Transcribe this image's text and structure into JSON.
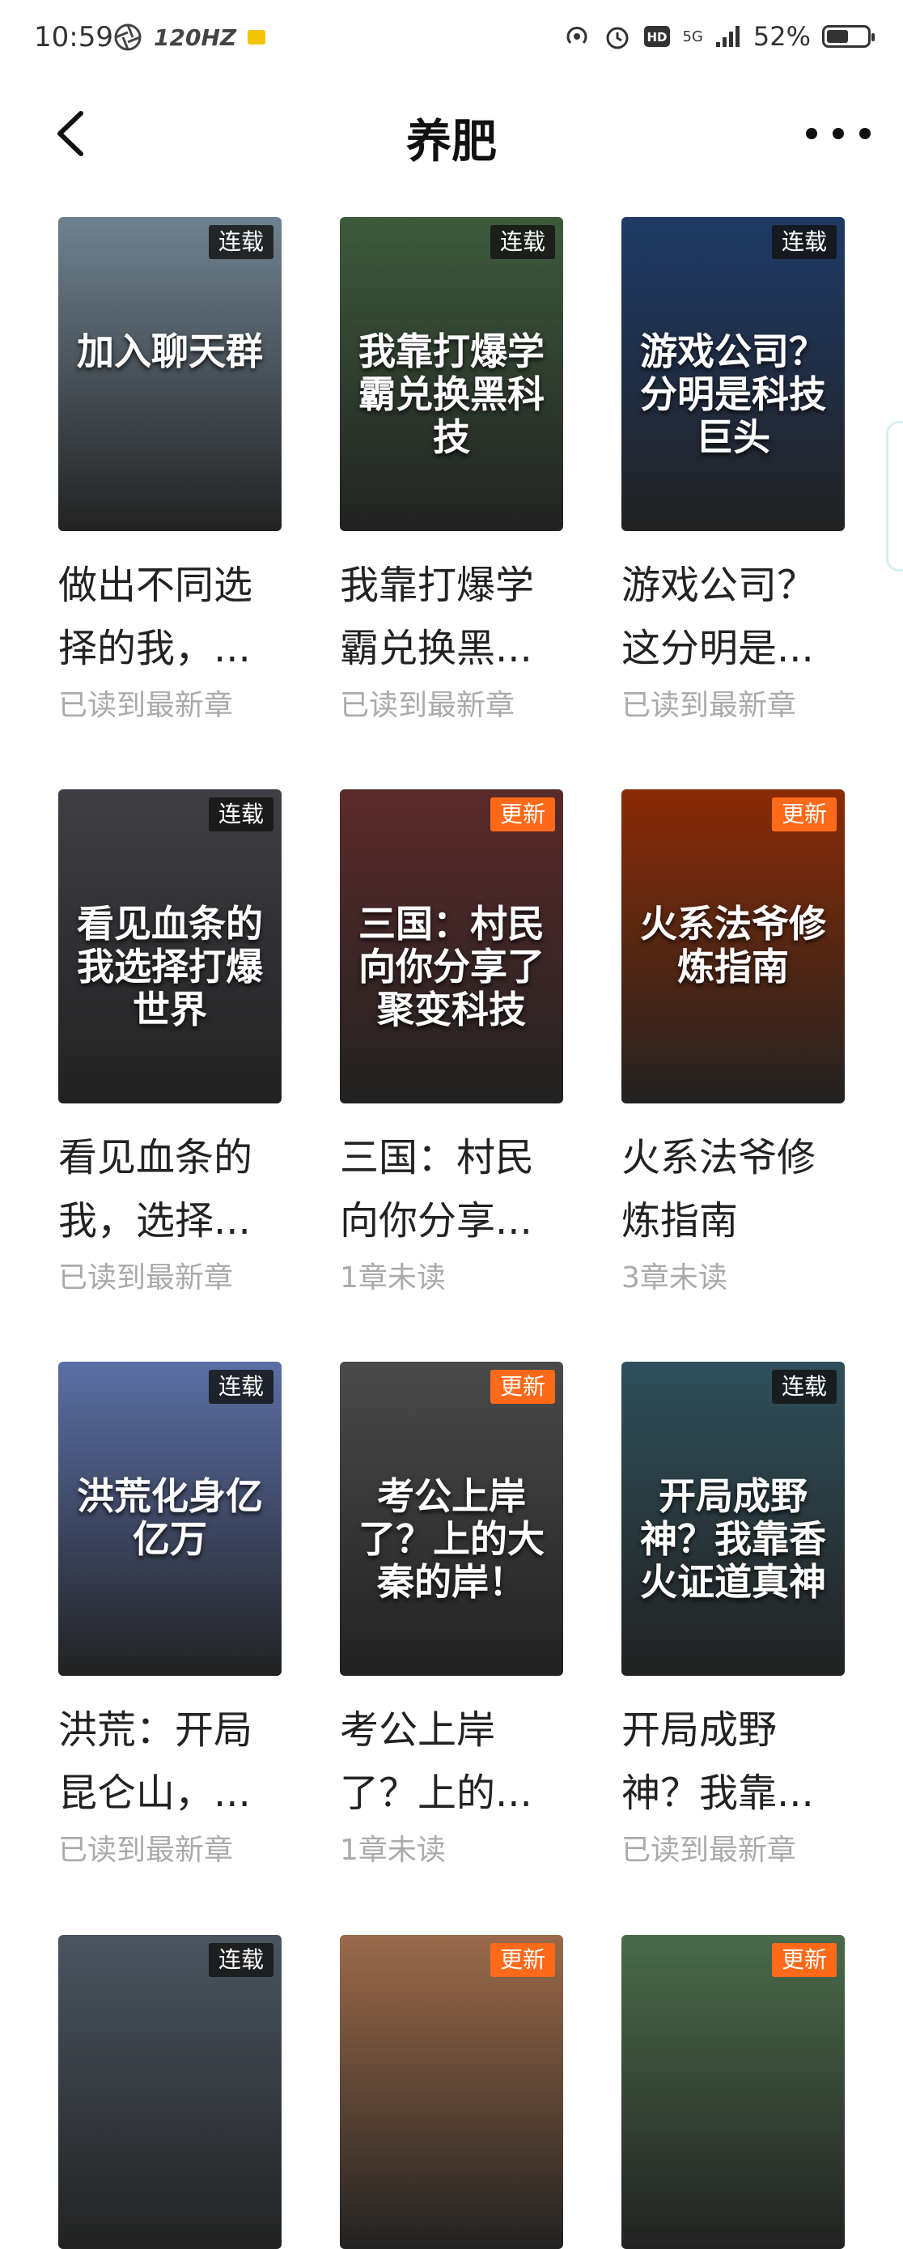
{
  "status_bar": {
    "time": "10:59",
    "refresh": "120HZ",
    "network": "5G",
    "battery": "52%"
  },
  "header": {
    "title": "养肥"
  },
  "books": [
    {
      "cover_text": "加入聊天群",
      "badge": "连载",
      "badge_type": "serial",
      "title_line1": "做出不同选",
      "title_line2": "择的我，...",
      "status": "已读到最新章",
      "cover_color": "#6f8290"
    },
    {
      "cover_text": "我靠打爆学霸兑换黑科技",
      "badge": "连载",
      "badge_type": "serial",
      "title_line1": "我靠打爆学",
      "title_line2": "霸兑换黑...",
      "status": "已读到最新章",
      "cover_color": "#3d5a3c"
    },
    {
      "cover_text": "游戏公司？分明是科技巨头",
      "badge": "连载",
      "badge_type": "serial",
      "title_line1": "游戏公司？",
      "title_line2": "这分明是...",
      "status": "已读到最新章",
      "cover_color": "#1f3a66"
    },
    {
      "cover_text": "看见血条的我选择打爆世界",
      "badge": "连载",
      "badge_type": "serial",
      "title_line1": "看见血条的",
      "title_line2": "我，选择...",
      "status": "已读到最新章",
      "cover_color": "#3e3e44"
    },
    {
      "cover_text": "三国：村民向你分享了聚变科技",
      "badge": "更新",
      "badge_type": "update",
      "title_line1": "三国：村民",
      "title_line2": "向你分享...",
      "status": "1章未读",
      "cover_color": "#5a2a2a"
    },
    {
      "cover_text": "火系法爷修炼指南",
      "badge": "更新",
      "badge_type": "update",
      "title_line1": "火系法爷修",
      "title_line2": "炼指南",
      "status": "3章未读",
      "cover_color": "#8a2b05"
    },
    {
      "cover_text": "洪荒化身亿亿万",
      "badge": "连载",
      "badge_type": "serial",
      "title_line1": "洪荒：开局",
      "title_line2": "昆仑山，...",
      "status": "已读到最新章",
      "cover_color": "#5b6fa6"
    },
    {
      "cover_text": "考公上岸了？上的大秦的岸！",
      "badge": "更新",
      "badge_type": "update",
      "title_line1": "考公上岸",
      "title_line2": "了？上的...",
      "status": "1章未读",
      "cover_color": "#4a4a4a"
    },
    {
      "cover_text": "开局成野神？我靠香火证道真神",
      "badge": "连载",
      "badge_type": "serial",
      "title_line1": "开局成野",
      "title_line2": "神？我靠...",
      "status": "已读到最新章",
      "cover_color": "#2f4f5a"
    },
    {
      "cover_text": "",
      "badge": "连载",
      "badge_type": "serial",
      "title_line1": "",
      "title_line2": "",
      "status": "",
      "cover_color": "#4a5560"
    },
    {
      "cover_text": "",
      "badge": "更新",
      "badge_type": "update",
      "title_line1": "",
      "title_line2": "",
      "status": "",
      "cover_color": "#9a6a4a"
    },
    {
      "cover_text": "",
      "badge": "更新",
      "badge_type": "update",
      "title_line1": "",
      "title_line2": "",
      "status": "",
      "cover_color": "#4a6a4a"
    }
  ]
}
